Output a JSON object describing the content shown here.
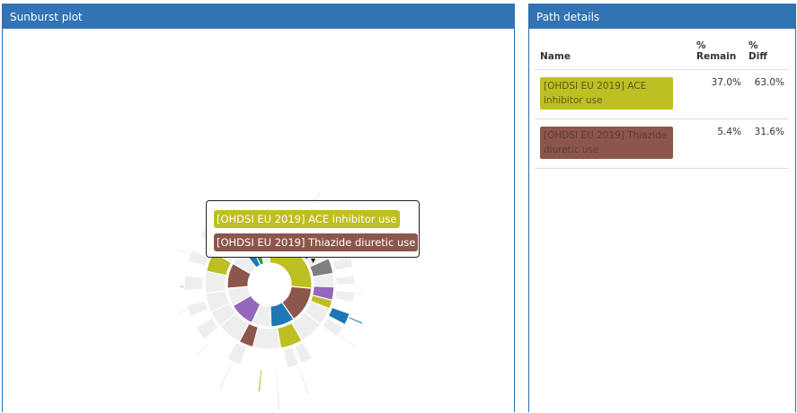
{
  "sunburst_panel": {
    "title": "Sunburst plot"
  },
  "tooltip": {
    "items": [
      {
        "label": "[OHDSI EU 2019] ACE inhibitor use",
        "color": "#bdbf22"
      },
      {
        "label": "[OHDSI EU 2019] Thiazide diuretic use",
        "color": "#8c564b"
      }
    ]
  },
  "details_panel": {
    "title": "Path details",
    "columns": {
      "name": "Name",
      "remain": "% Remain",
      "diff": "% Diff"
    },
    "rows": [
      {
        "name": "[OHDSI EU 2019] ACE inhibitor use",
        "remain": "37.0%",
        "diff": "63.0%",
        "bg": "#bdbf22",
        "fg": "#5a5a1e"
      },
      {
        "name": "[OHDSI EU 2019] Thiazide diuretic use",
        "remain": "5.4%",
        "diff": "31.6%",
        "bg": "#8c564b",
        "fg": "#5e3b35"
      }
    ]
  },
  "colors": {
    "ace": "#bdbf22",
    "thiazide": "#8c564b",
    "blue": "#1f77b4",
    "purple": "#9467bd",
    "gray": "#7f7f7f",
    "green": "#2ca02c",
    "orange": "#ff7f0e",
    "empty": "#eeeeee",
    "header": "#3173b3"
  }
}
